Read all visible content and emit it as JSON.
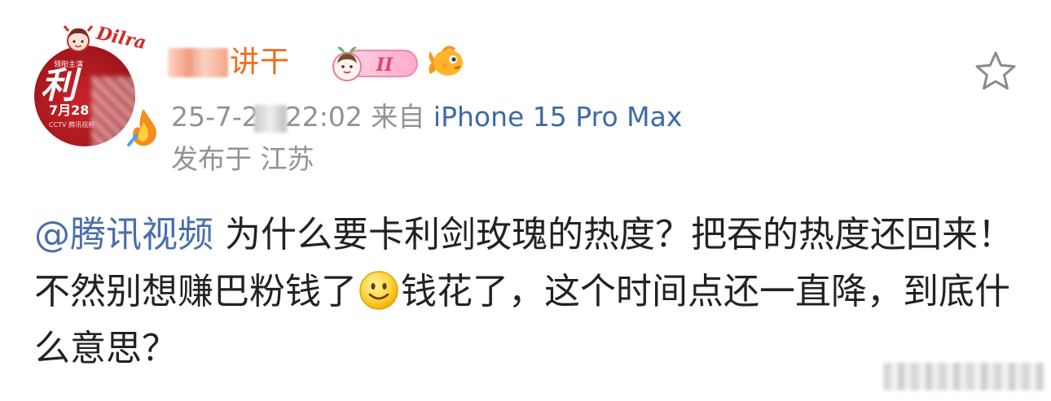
{
  "user": {
    "name_visible": "讲干",
    "member_badge_text": "II"
  },
  "meta": {
    "date_part1": "25-7-2",
    "date_part2": "22:02",
    "source_label": "来自",
    "device": "iPhone 15 Pro Max",
    "location": "发布于 江苏"
  },
  "avatar": {
    "badge_text": "Dilra",
    "top_small_text": "领衔主演",
    "big_text": "利",
    "date_text": "7月28",
    "logos_text": "CCTV 腾讯视频"
  },
  "post": {
    "mention": "@腾讯视频",
    "text_part1": " 为什么要卡利剑玫瑰的热度？把吞的热度还回来！不然别想赚巴粉钱了",
    "text_part2": "钱花了，这个时间点还一直降，到底什么意思？"
  },
  "icons": {
    "favorite": "star-outline-icon",
    "emoji": "smile-emoji-icon",
    "member": "member-badge-icon",
    "fish": "fish-emblem-icon"
  },
  "colors": {
    "username": "#f26a1b",
    "meta_gray": "#929292",
    "device_blue": "#3d6aa8",
    "mention_blue": "#4a6fa8",
    "body_text": "#222222",
    "avatar_red": "#b51d23"
  }
}
